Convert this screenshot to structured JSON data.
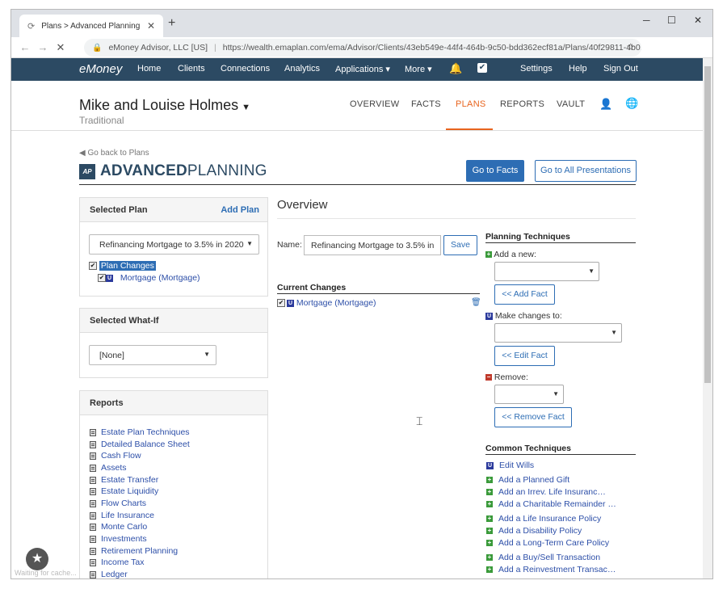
{
  "browser": {
    "tab_title": "Plans > Advanced Planning",
    "url_site": "eMoney Advisor, LLC [US]",
    "url": "https://wealth.emaplan.com/ema/Advisor/Clients/43eb549e-44f4-464b-9c50-bdd362ecf81a/Plans/40f29811-4b0...",
    "status": "Waiting for cache..."
  },
  "topnav": {
    "logo": "eMoney",
    "items": [
      "Home",
      "Clients",
      "Connections",
      "Analytics",
      "Applications ▾",
      "More ▾"
    ],
    "right": [
      "Settings",
      "Help",
      "Sign Out"
    ]
  },
  "client": {
    "name": "Mike and Louise Holmes",
    "subtitle": "Traditional",
    "tabs": [
      "OVERVIEW",
      "FACTS",
      "PLANS",
      "REPORTS",
      "VAULT"
    ]
  },
  "page": {
    "back": "Go back to Plans",
    "badge": "AP",
    "title_bold": "ADVANCED",
    "title_light": "PLANNING",
    "go_facts": "Go to Facts",
    "go_presentations": "Go to All Presentations"
  },
  "selected_plan": {
    "header": "Selected Plan",
    "add": "Add Plan",
    "value": "Refinancing Mortgage to 3.5% in 2020",
    "tree_root": "Plan Changes",
    "tree_child": "Mortgage (Mortgage)"
  },
  "what_if": {
    "header": "Selected What-If",
    "value": "[None]"
  },
  "reports": {
    "header": "Reports",
    "items": [
      "Estate Plan Techniques",
      "Detailed Balance Sheet",
      "Cash Flow",
      "Assets",
      "Estate Transfer",
      "Estate Liquidity",
      "Flow Charts",
      "Life Insurance",
      "Monte Carlo",
      "Investments",
      "Retirement Planning",
      "Income Tax",
      "Ledger"
    ]
  },
  "overview": {
    "title": "Overview",
    "name_label": "Name:",
    "name_value": "Refinancing Mortgage to 3.5% in",
    "save": "Save",
    "current_changes": "Current Changes",
    "change_item": "Mortgage (Mortgage)"
  },
  "planning": {
    "header": "Planning Techniques",
    "add_new": "Add a new:",
    "add_fact": "<< Add Fact",
    "make_changes": "Make changes to:",
    "edit_fact": "<< Edit Fact",
    "remove": "Remove:",
    "remove_fact": "<< Remove Fact"
  },
  "common": {
    "header": "Common Techniques",
    "items": [
      "Edit Wills",
      "Add a Planned Gift",
      "Add an Irrev. Life Insuranc…",
      "Add a Charitable Remainder …",
      "Add a Life Insurance Policy",
      "Add a Disability Policy",
      "Add a Long-Term Care Policy",
      "Add a Buy/Sell Transaction",
      "Add a Reinvestment Transac…"
    ]
  }
}
